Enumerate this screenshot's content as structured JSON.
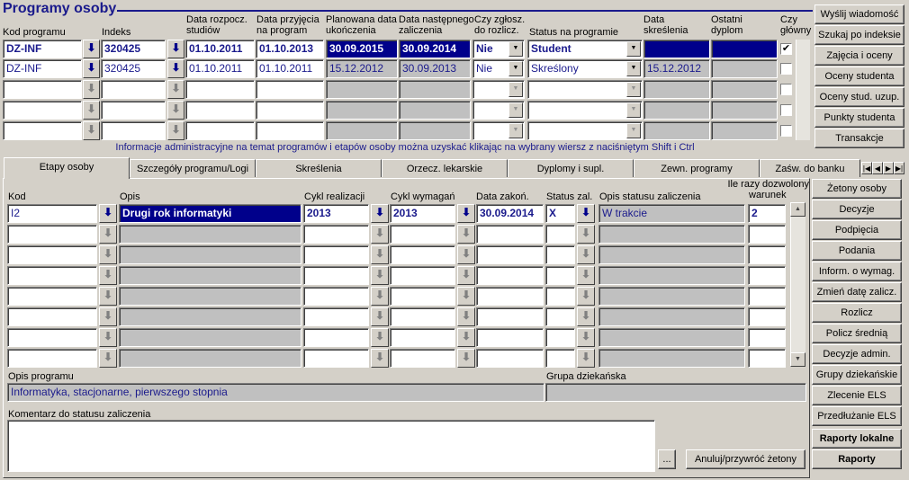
{
  "window": {
    "title": "Programy osoby"
  },
  "top": {
    "headers": {
      "kod_programu": "Kod programu",
      "indeks": "Indeks",
      "data_rozpocz_1": "Data rozpocz.",
      "data_rozpocz_2": "studiów",
      "data_przyjecia_1": "Data przyjęcia",
      "data_przyjecia_2": "na program",
      "planowana_1": "Planowana data",
      "planowana_2": "ukończenia",
      "nastepnego_1": "Data następnego",
      "nastepnego_2": "zaliczenia",
      "zglosz_1": "Czy zgłosz.",
      "zglosz_2": "do rozlicz.",
      "status": "Status na programie",
      "skreslenia_1": "Data",
      "skreslenia_2": "skreślenia",
      "dyplom_1": "Ostatni",
      "dyplom_2": "dyplom",
      "glowny_1": "Czy",
      "glowny_2": "główny"
    },
    "rows": [
      {
        "kod": "DZ-INF",
        "indeks": "320425",
        "rozp": "01.10.2011",
        "przyj": "01.10.2013",
        "plan": "30.09.2015",
        "nast": "30.09.2014",
        "zglosz": "Nie",
        "status": "Student",
        "skresl": "",
        "dyplom": "",
        "glowny": "✔"
      },
      {
        "kod": "DZ-INF",
        "indeks": "320425",
        "rozp": "01.10.2011",
        "przyj": "01.10.2011",
        "plan": "15.12.2012",
        "nast": "30.09.2013",
        "zglosz": "Nie",
        "status": "Skreślony",
        "skresl": "15.12.2012",
        "dyplom": "",
        "glowny": ""
      }
    ],
    "info": "Informacje administracyjne na temat programów i etapów osoby można uzyskać klikając na wybrany wiersz z naciśniętym Shift i Ctrl"
  },
  "side_buttons_top": [
    "Wyślij wiadomość",
    "Szukaj po indeksie",
    "Zajęcia i oceny",
    "Oceny studenta",
    "Oceny stud. uzup.",
    "Punkty studenta",
    "Transakcje"
  ],
  "tabs": [
    "Etapy osoby",
    "Szczegóły programu/Logi",
    "Skreślenia",
    "Orzecz. lekarskie",
    "Dyplomy i supl.",
    "Zewn. programy",
    "Zaśw. do banku"
  ],
  "etapy": {
    "headers": {
      "kod": "Kod",
      "opis": "Opis",
      "cykl_real": "Cykl realizacji",
      "cykl_wym": "Cykl wymagań",
      "data_zak": "Data zakoń.",
      "status_zal": "Status zal.",
      "opis_statusu": "Opis statusu zaliczenia",
      "ile_razy_1": "Ile razy dozwolony",
      "ile_razy_2": "warunek"
    },
    "row": {
      "kod": "I2",
      "opis": "Drugi rok informatyki",
      "cykl_real": "2013",
      "cykl_wym": "2013",
      "data_zak": "30.09.2014",
      "status_zal": "X",
      "opis_statusu": "W trakcie",
      "ile": "2"
    }
  },
  "side_buttons_bottom": [
    "Żetony osoby",
    "Decyzje",
    "Podpięcia",
    "Podania",
    "Inform. o wymag.",
    "Zmień datę zalicz.",
    "Rozlicz",
    "Policz średnią",
    "Decyzje admin.",
    "Grupy dziekańskie",
    "Zlecenie ELS",
    "Przedłużanie ELS",
    "Raporty lokalne",
    "Raporty"
  ],
  "bottom": {
    "opis_programu_label": "Opis programu",
    "opis_programu_value": "Informatyka, stacjonarne, pierwszego stopnia",
    "grupa_label": "Grupa dziekańska",
    "grupa_value": "",
    "komentarz_label": "Komentarz do statusu zaliczenia",
    "ellipsis": "...",
    "anuluj": "Anuluj/przywróć żetony"
  },
  "icons": {
    "download": "download-arrow-icon",
    "dropdown": "chevron-down-icon"
  }
}
